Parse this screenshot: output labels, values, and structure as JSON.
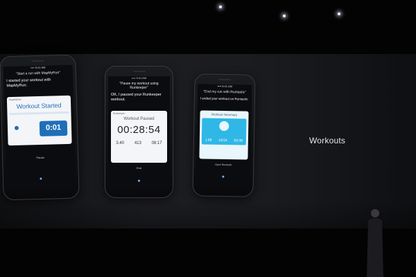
{
  "caption": "Workouts",
  "phone1": {
    "siri_query": "“Start a run with MapMyRun”",
    "siri_reply": "I started your workout with MapMyRun:",
    "app_name": "MapMyRun",
    "card_title": "Workout Started",
    "timer": "0:01",
    "action": "Pause"
  },
  "phone2": {
    "siri_query": "“Pause my workout using Runkeeper”",
    "siri_reply": "OK, I paused your Runkeeper workout.",
    "app_name": "Runkeeper",
    "card_title": "Workout Paused",
    "timer": "00:28:54",
    "stats": [
      "3.40",
      "413",
      "08:17"
    ],
    "action": "End"
  },
  "phone3": {
    "siri_query": "“End my run with Runtastic”",
    "siri_reply": "I ended your workout on Runtastic:",
    "card_title": "Workout Summary",
    "stats": [
      "1.69",
      "18:54",
      "05:38"
    ],
    "action": "Open Runtastic"
  },
  "colors": {
    "stage_background": "#030303",
    "mapmyrun_blue": "#1f6fb8",
    "runtastic_cyan": "#2fb7e6",
    "siri_mic": "#7fb3ff"
  }
}
